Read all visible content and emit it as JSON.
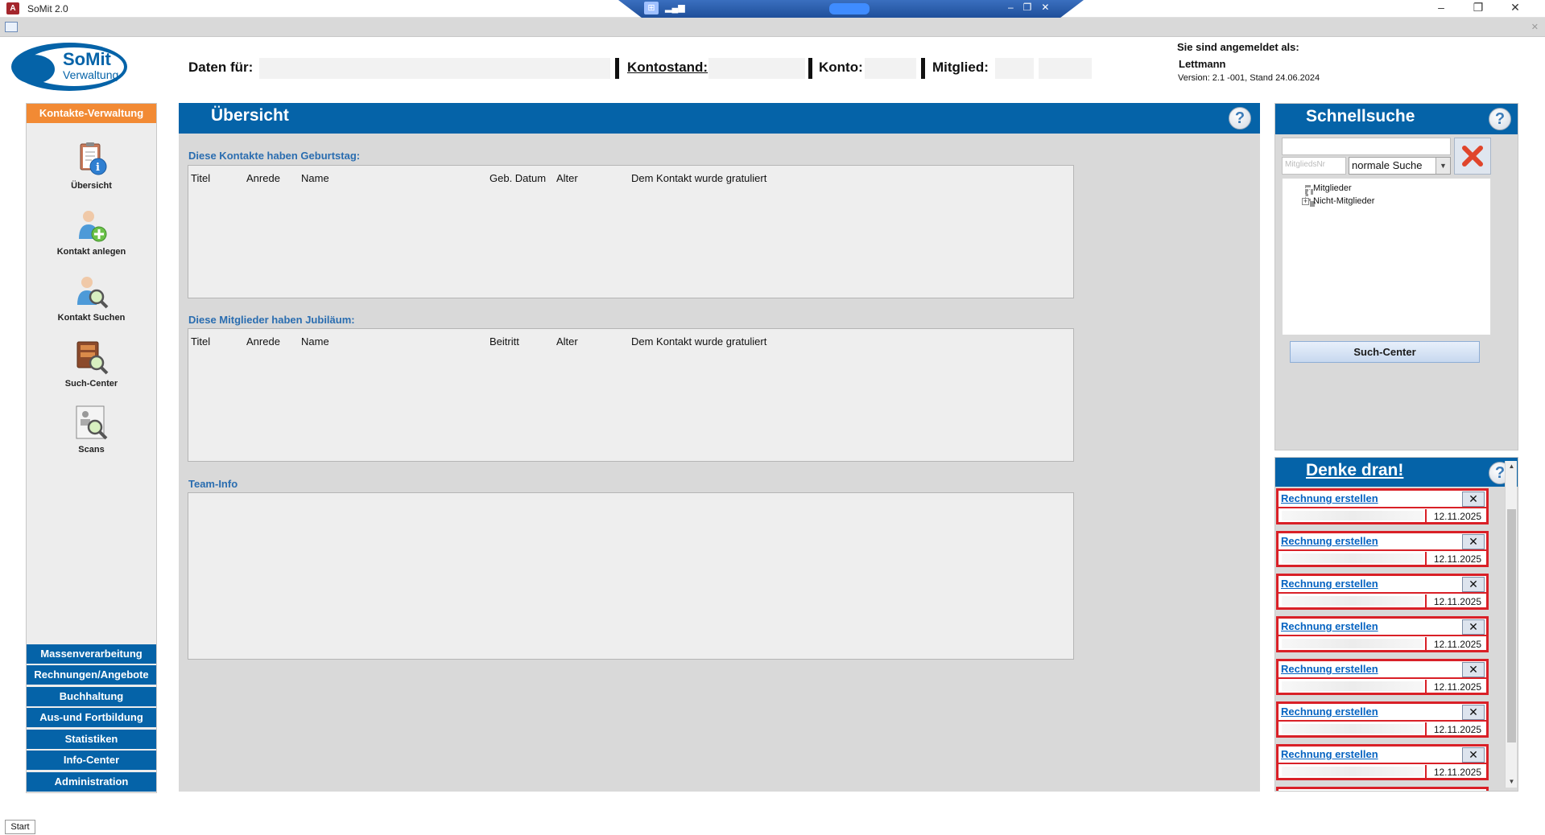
{
  "window": {
    "title": "SoMit 2.0",
    "app_icon_letter": "A"
  },
  "logo": {
    "line1": "SoMit",
    "line2": "Verwaltung"
  },
  "header": {
    "daten_fuer_label": "Daten für:",
    "kontostand_label": "Kontostand:",
    "konto_label": "Konto:",
    "mitglied_label": "Mitglied:"
  },
  "login": {
    "title": "Sie sind angemeldet als:",
    "user": "Lettmann",
    "version": "Version: 2.1 -001, Stand 24.06.2024"
  },
  "nav": {
    "header": "Kontakte-Verwaltung",
    "items": [
      {
        "label": "Übersicht",
        "icon": "clipboard-info-icon"
      },
      {
        "label": "Kontakt anlegen",
        "icon": "add-person-icon"
      },
      {
        "label": "Kontakt Suchen",
        "icon": "search-person-icon"
      },
      {
        "label": "Such-Center",
        "icon": "search-book-icon"
      },
      {
        "label": "Scans",
        "icon": "scan-search-icon"
      }
    ],
    "buttons": [
      "Massenverarbeitung",
      "Rechnungen/Angebote",
      "Buchhaltung",
      "Aus-und Fortbildung",
      "Statistiken",
      "Info-Center",
      "Administration"
    ]
  },
  "main": {
    "title": "Übersicht",
    "birthday": {
      "title": "Diese Kontakte haben Geburtstag:",
      "columns": [
        "Titel",
        "Anrede",
        "Name",
        "Geb. Datum",
        "Alter",
        "Dem Kontakt wurde gratuliert"
      ]
    },
    "jubilee": {
      "title": "Diese Mitglieder haben Jubiläum:",
      "columns": [
        "Titel",
        "Anrede",
        "Name",
        "Beitritt",
        "Alter",
        "Dem Kontakt wurde gratuliert"
      ]
    },
    "team": {
      "title": "Team-Info"
    }
  },
  "quicksearch": {
    "title": "Schnellsuche",
    "nr_placeholder": "MitgliedsNr",
    "mode": "normale Suche",
    "tree": [
      "Mitglieder",
      "Nicht-Mitglieder"
    ],
    "button": "Such-Center"
  },
  "reminders": {
    "title": "Denke dran!",
    "items": [
      {
        "label": "Rechnung erstellen",
        "date": "12.11.2025"
      },
      {
        "label": "Rechnung erstellen",
        "date": "12.11.2025"
      },
      {
        "label": "Rechnung erstellen",
        "date": "12.11.2025"
      },
      {
        "label": "Rechnung erstellen",
        "date": "12.11.2025"
      },
      {
        "label": "Rechnung erstellen",
        "date": "12.11.2025"
      },
      {
        "label": "Rechnung erstellen",
        "date": "12.11.2025"
      },
      {
        "label": "Rechnung erstellen",
        "date": "12.11.2025"
      }
    ]
  },
  "taskbar": {
    "start": "Start"
  },
  "colors": {
    "accent_blue": "#0563a8",
    "nav_orange": "#f28a34",
    "reminder_red": "#d92027"
  }
}
